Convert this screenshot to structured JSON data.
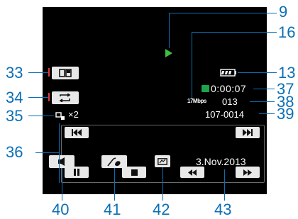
{
  "callouts": {
    "c9": "9",
    "c16": "16",
    "c13": "13",
    "c37": "37",
    "c38": "38",
    "c39": "39",
    "c33": "33",
    "c34": "34",
    "c35": "35",
    "c36": "36",
    "c40": "40",
    "c41": "41",
    "c42": "42",
    "c43": "43"
  },
  "screen": {
    "play_indicator_icon": "play-icon",
    "battery_icon": "battery-icon",
    "time": "0:00:07",
    "bitrate": "17Mbps",
    "scene_counter": "013",
    "file_number": "107-0014",
    "speed_label": "×2",
    "date": "3.Nov.2013"
  },
  "colors": {
    "callout": "#0a6fb5",
    "screen_bg": "#000000",
    "button_bg": "#e8e8e8",
    "play_green": "#3fbf3f",
    "sd_green": "#1fa34a",
    "marker_red": "#e23b3b"
  }
}
